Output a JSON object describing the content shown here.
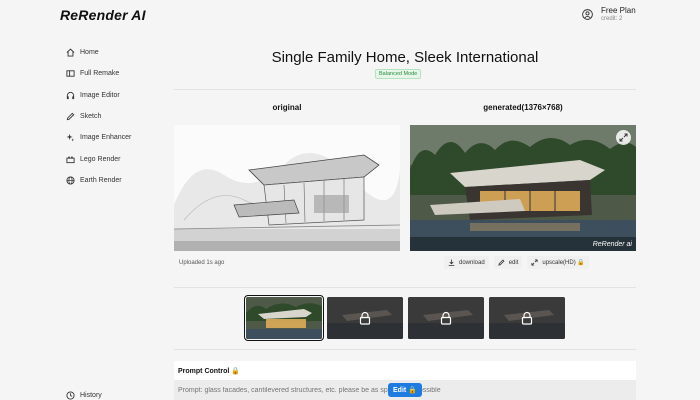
{
  "app": {
    "brand": "ReRender AI"
  },
  "account": {
    "plan": "Free Plan",
    "credit": "credit: 2"
  },
  "sidebar": {
    "items": [
      {
        "label": "Home",
        "icon": "home-icon"
      },
      {
        "label": "Full Remake",
        "icon": "remake-icon"
      },
      {
        "label": "Image Editor",
        "icon": "headphones-icon"
      },
      {
        "label": "Sketch",
        "icon": "pencil-icon"
      },
      {
        "label": "Image Enhancer",
        "icon": "sparkle-icon"
      },
      {
        "label": "Lego Render",
        "icon": "lego-icon"
      },
      {
        "label": "Earth Render",
        "icon": "globe-icon"
      }
    ],
    "history": "History"
  },
  "main": {
    "title": "Single Family Home, Sleek International",
    "mode": "Balanced Mode",
    "original_label": "original",
    "generated_label": "generated(1376×768)",
    "uploaded": "Uploaded 1s ago",
    "watermark": "ReRender ai",
    "actions": {
      "download": "download",
      "edit": "edit",
      "upscale": "upscale(HD) 🔒"
    }
  },
  "prompt": {
    "title": "Prompt Control 🔒",
    "placeholder": "Prompt: glass facades, cantilevered structures, etc. please be as specific as possible",
    "edit_label": "Edit 🔒"
  },
  "colors": {
    "accent": "#1e7ce0",
    "mode_badge": "#2c8a3e"
  }
}
